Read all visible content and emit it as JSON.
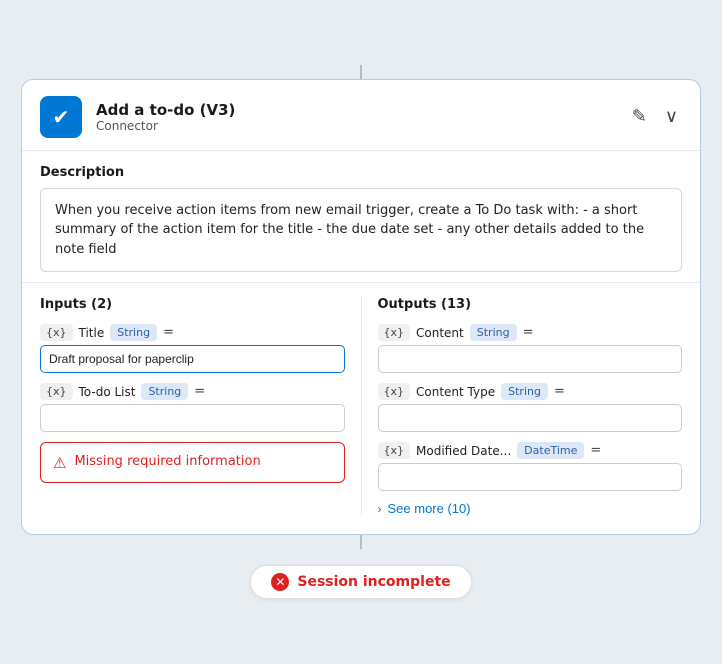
{
  "header": {
    "title": "Add a to-do (V3)",
    "subtitle": "Connector",
    "icon_label": "checkmark"
  },
  "description": {
    "label": "Description",
    "text": "When you receive action items from new email trigger, create a To Do task with: - a short summary of the action item for the title - the due date set - any other details added to the note field"
  },
  "inputs": {
    "label": "Inputs (2)",
    "fields": [
      {
        "expr": "{x}",
        "name": "Title",
        "type": "String",
        "equals": "=",
        "value": "Draft proposal for paperclip",
        "filled": true
      },
      {
        "expr": "{x}",
        "name": "To-do List",
        "type": "String",
        "equals": "=",
        "value": "",
        "filled": false
      }
    ],
    "error": {
      "text": "Missing required information"
    }
  },
  "outputs": {
    "label": "Outputs (13)",
    "fields": [
      {
        "expr": "{x}",
        "name": "Content",
        "type": "String",
        "equals": "=",
        "value": ""
      },
      {
        "expr": "{x}",
        "name": "Content Type",
        "type": "String",
        "equals": "=",
        "value": ""
      },
      {
        "expr": "{x}",
        "name": "Modified Date...",
        "type": "DateTime",
        "equals": "=",
        "value": ""
      }
    ],
    "see_more": "See more (10)"
  },
  "session": {
    "text": "Session incomplete",
    "error_icon": "✕"
  },
  "actions": {
    "edit_icon": "✎",
    "collapse_icon": "∨"
  }
}
